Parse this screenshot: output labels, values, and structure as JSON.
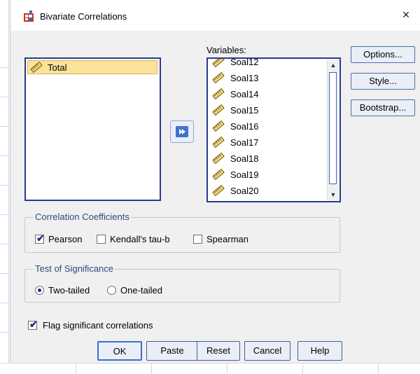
{
  "dialog": {
    "title": "Bivariate Correlations",
    "close_glyph": "×"
  },
  "source_list": {
    "items": [
      {
        "label": "Total",
        "selected": true,
        "icon": "scale-ruler-icon"
      }
    ]
  },
  "variables": {
    "label": "Variables:",
    "items": [
      {
        "label": "Soal12",
        "icon": "scale-ruler-icon"
      },
      {
        "label": "Soal13",
        "icon": "scale-ruler-icon"
      },
      {
        "label": "Soal14",
        "icon": "scale-ruler-icon"
      },
      {
        "label": "Soal15",
        "icon": "scale-ruler-icon"
      },
      {
        "label": "Soal16",
        "icon": "scale-ruler-icon"
      },
      {
        "label": "Soal17",
        "icon": "scale-ruler-icon"
      },
      {
        "label": "Soal18",
        "icon": "scale-ruler-icon"
      },
      {
        "label": "Soal19",
        "icon": "scale-ruler-icon"
      },
      {
        "label": "Soal20",
        "icon": "scale-ruler-icon"
      }
    ]
  },
  "side_buttons": {
    "options": "Options...",
    "style": "Style...",
    "bootstrap": "Bootstrap..."
  },
  "correlation": {
    "title": "Correlation Coefficients",
    "pearson": {
      "label": "Pearson",
      "checked": true
    },
    "kendall": {
      "label": "Kendall's tau-b",
      "checked": false
    },
    "spearman": {
      "label": "Spearman",
      "checked": false
    }
  },
  "significance": {
    "title": "Test of Significance",
    "two_tailed": {
      "label": "Two-tailed",
      "selected": true
    },
    "one_tailed": {
      "label": "One-tailed",
      "selected": false
    }
  },
  "flag": {
    "label": "Flag significant correlations",
    "checked": true
  },
  "buttons": {
    "ok": "OK",
    "paste": "Paste",
    "reset": "Reset",
    "cancel": "Cancel",
    "help": "Help"
  },
  "colors": {
    "accent": "#2a3a8c",
    "selection": "#fbe39b",
    "group_title": "#2b4a7f",
    "dialog_bg": "#f0f0f0"
  }
}
